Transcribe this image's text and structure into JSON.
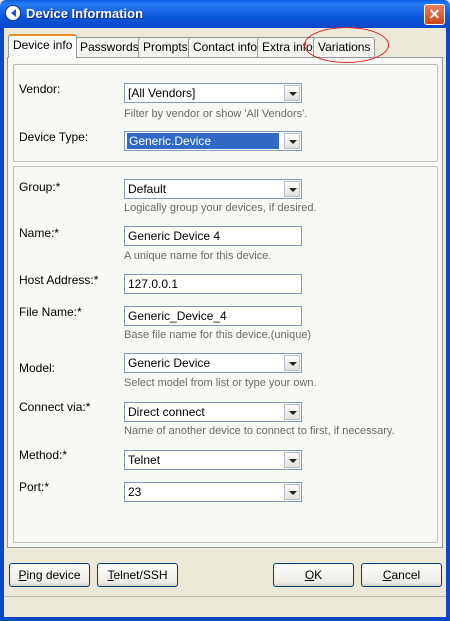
{
  "window": {
    "title": "Device Information",
    "close_label": "✕"
  },
  "tabs": [
    {
      "label": "Device info"
    },
    {
      "label": "Passwords"
    },
    {
      "label": "Prompts"
    },
    {
      "label": "Contact info"
    },
    {
      "label": "Extra info"
    },
    {
      "label": "Variations"
    }
  ],
  "fields": {
    "vendor": {
      "label": "Vendor:",
      "value": "[All Vendors]",
      "hint": "Filter by vendor or show 'All Vendors'."
    },
    "device_type": {
      "label": "Device Type:",
      "value": "Generic.Device"
    },
    "group": {
      "label": "Group:*",
      "value": "Default",
      "hint": "Logically group your devices, if desired."
    },
    "name": {
      "label": "Name:*",
      "value": "Generic Device 4",
      "hint": "A unique name for this device."
    },
    "host": {
      "label": "Host Address:*",
      "value": "127.0.0.1"
    },
    "file_name": {
      "label": "File Name:*",
      "value": "Generic_Device_4",
      "hint": "Base file name for this device.(unique)"
    },
    "model": {
      "label": "Model:",
      "value": "Generic Device",
      "hint": "Select model from list or type your own."
    },
    "connect_via": {
      "label": "Connect via:*",
      "value": "Direct connect",
      "hint": "Name of another device to connect to first, if necessary."
    },
    "method": {
      "label": "Method:*",
      "value": "Telnet"
    },
    "port": {
      "label": "Port:*",
      "value": "23"
    }
  },
  "buttons": {
    "ping": {
      "first": "P",
      "rest": "ing device"
    },
    "telnet": {
      "first": "T",
      "rest": "elnet/SSH"
    },
    "ok": {
      "first": "O",
      "rest": "K"
    },
    "cancel": {
      "first": "C",
      "rest": "ancel"
    }
  },
  "colors": {
    "title_bar": "#0a55d8",
    "selection": "#316ac5",
    "annotation": "#e02020"
  }
}
